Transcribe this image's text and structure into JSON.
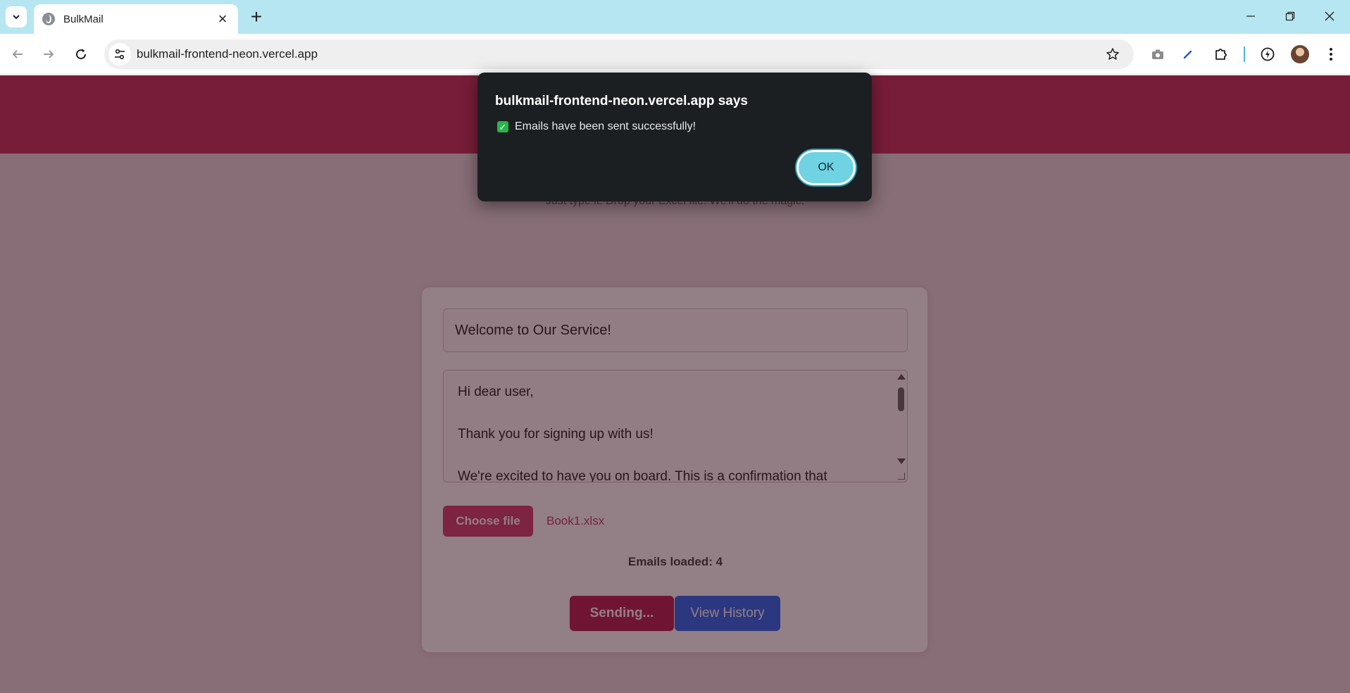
{
  "browser": {
    "tab_title": "BulkMail",
    "url": "bulkmail-frontend-neon.vercel.app",
    "icons": {
      "tab_list": "chevron-down-icon",
      "favicon": "globe-icon",
      "tab_close": "close-icon",
      "new_tab": "plus-icon",
      "back": "arrow-left-icon",
      "forward": "arrow-right-icon",
      "reload": "reload-icon",
      "site_info": "tune-icon",
      "bookmark": "star-icon",
      "screenshot": "camera-icon",
      "pen": "pen-icon",
      "extensions": "puzzle-icon",
      "performance": "bolt-icon",
      "menu": "kebab-menu-icon"
    }
  },
  "page": {
    "tagline": "Just type it. Drop your Excel file. We'll do the magic.",
    "subject_value": "Welcome to Our Service!",
    "body_value": "Hi dear user,\n\nThank you for signing up with us!\n\nWe're excited to have you on board. This is a confirmation that",
    "choose_file_label": "Choose file",
    "file_name": "Book1.xlsx",
    "emails_loaded": "Emails loaded: 4",
    "send_label": "Sending...",
    "history_label": "View History"
  },
  "dialog": {
    "title": "bulkmail-frontend-neon.vercel.app says",
    "check_glyph": "✓",
    "message": "Emails have been sent successfully!",
    "ok_label": "OK"
  },
  "colors": {
    "tabstrip": "#b6e6f1",
    "header": "#c93a64",
    "primary_pink": "#d14874",
    "send_button": "#b8285a",
    "history_button": "#2f6ef0",
    "dialog_bg": "#1c1f21",
    "ok_button": "#6fd3e3",
    "success_check": "#29b54a"
  }
}
